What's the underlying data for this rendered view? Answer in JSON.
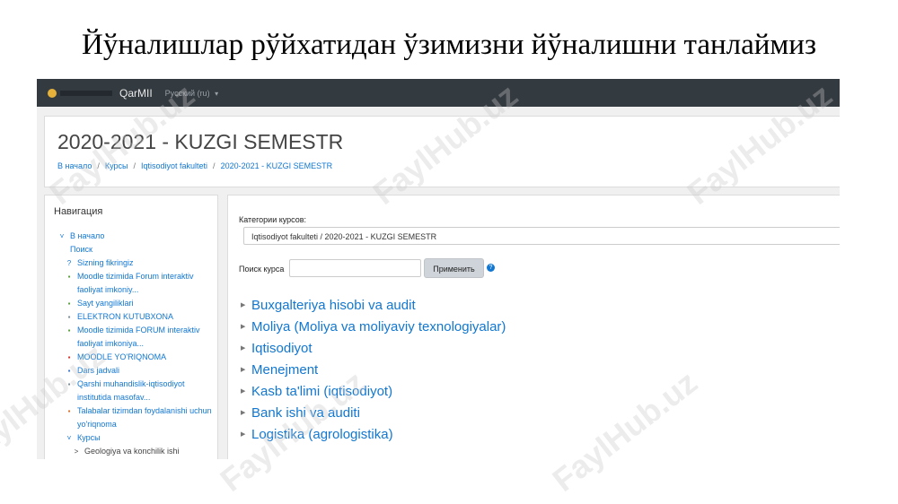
{
  "slide": {
    "title": "Йўналишлар рўйхатидан ўзимизни йўналишни танлаймиз"
  },
  "navbar": {
    "site_name": "QarMII",
    "language": "Русский (ru)",
    "caret": "▾"
  },
  "header": {
    "title": "2020-2021 - KUZGI SEMESTR",
    "breadcrumb": [
      "В начало",
      "Курсы",
      "Iqtisodiyot fakulteti",
      "2020-2021 - KUZGI SEMESTR"
    ],
    "separator": "/"
  },
  "navigation": {
    "title": "Навигация",
    "items": [
      {
        "icon": "˅",
        "label": "В начало"
      },
      {
        "icon": "",
        "label": "Поиск"
      },
      {
        "icon": "?",
        "label": "Sizning fikringiz"
      },
      {
        "icon": "▪",
        "label": "Moodle tizimida Forum interaktiv faoliyat imkoniy..."
      },
      {
        "icon": "▪",
        "label": "Sayt yangiliklari"
      },
      {
        "icon": "▪",
        "label": "ELEKTRON KUTUBXONA"
      },
      {
        "icon": "▪",
        "label": "Moodle tizimida FORUM interaktiv faoliyat imkoniya..."
      },
      {
        "icon": "▪",
        "label": "MOODLE YO'RIQNOMA"
      },
      {
        "icon": "▪",
        "label": "Dars jadvali"
      },
      {
        "icon": "▪",
        "label": "Qarshi muhandislik-iqtisodiyot institutida masofav..."
      },
      {
        "icon": "▪",
        "label": "Talabalar tizimdan foydalanishi uchun yo'riqnoma"
      },
      {
        "icon": "˅",
        "label": "Курсы"
      },
      {
        "icon": ">",
        "label": "Geologiya va konchilik ishi"
      }
    ]
  },
  "main": {
    "category_label": "Категории курсов:",
    "category_value": "Iqtisodiyot fakulteti / 2020-2021 - KUZGI SEMESTR",
    "search_label": "Поиск курса",
    "search_value": "",
    "apply_label": "Применить",
    "help_icon": "?",
    "course_arrow": "▶",
    "courses": [
      "Buxgalteriya hisobi va audit",
      "Moliya (Moliya va moliyaviy texnologiyalar)",
      "Iqtisodiyot",
      "Menejment",
      "Kasb ta'limi (iqtisodiyot)",
      "Bank ishi va auditi",
      "Logistika (agrologistika)"
    ]
  },
  "watermark": {
    "text": "FaylHub.uz"
  }
}
